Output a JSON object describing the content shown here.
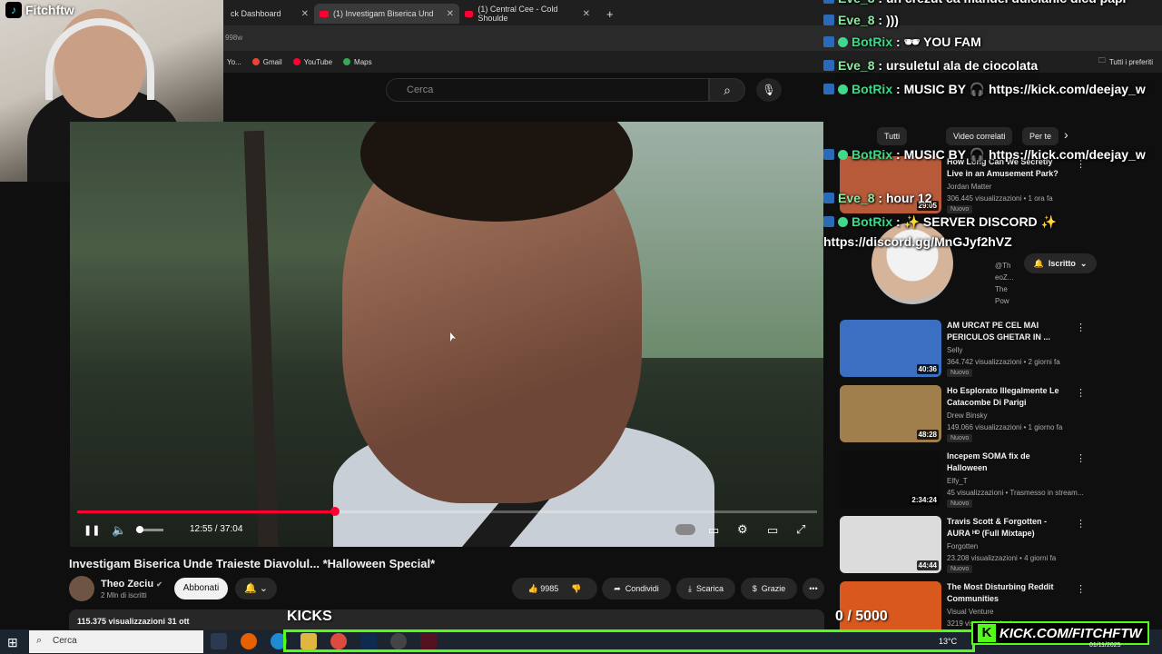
{
  "browser": {
    "tabs": [
      {
        "label": "ck Dashboard"
      },
      {
        "label": "(1) Investigam Biserica Und"
      },
      {
        "label": "(1) Central Cee - Cold Shoulde"
      }
    ],
    "close_glyph": "✕",
    "new_tab_glyph": "+",
    "address_fragment": "998w",
    "bookmarks": [
      {
        "label": "Yo..."
      },
      {
        "label": "Gmail"
      },
      {
        "label": "YouTube"
      },
      {
        "label": "Maps"
      }
    ],
    "all_bookmarks": "Tutti i preferiti"
  },
  "stream": {
    "streamer": "Fitchftw",
    "kicks_label": "KICKS",
    "kicks_count": "0 / 5000",
    "kick_url": "KICK.COM/FITCHFTW",
    "accent": "#53fc18"
  },
  "chat": [
    {
      "user": "Eve_8",
      "sep": " : ",
      "text": "un crezut ca manuel dulcianic dicu papi",
      "type": "eve"
    },
    {
      "user": "Eve_8",
      "sep": " : ",
      "text": ")))",
      "type": "eve"
    },
    {
      "user": "BotRix",
      "sep": " : ",
      "text": "🕶 YOU FAM",
      "type": "bot"
    },
    {
      "user": "Eve_8",
      "sep": " : ",
      "text": "ursuletul ala de ciocolata",
      "type": "eve"
    },
    {
      "user": "BotRix",
      "sep": " : ",
      "text": "MUSIC BY 🎧 https://kick.com/deejay_w",
      "type": "bot"
    },
    {
      "user": "BotRix",
      "sep": " : ",
      "text": "MUSIC BY 🎧 https://kick.com/deejay_w",
      "type": "bot"
    },
    {
      "user": "Eve_8",
      "sep": " : ",
      "text": "hour 12",
      "type": "eve"
    },
    {
      "user": "BotRix",
      "sep": " : ",
      "text": "✨ SERVER DISCORD ✨",
      "type": "bot"
    },
    {
      "user": "",
      "sep": "",
      "text": "https://discord.gg/MnGJyf2hVZ",
      "type": "plain"
    }
  ],
  "youtube": {
    "search_placeholder": "Cerca",
    "search_icon": "search-icon",
    "mic_icon": "mic-icon",
    "player": {
      "time": "12:55 / 37:04",
      "progress": 0.348,
      "pause_glyph": "❚❚",
      "volume_glyph": "🔈",
      "cc_glyph": "▭",
      "settings_glyph": "⚙",
      "theater_glyph": "▭",
      "fullscreen_glyph": "⤢"
    },
    "video_title": "Investigam Biserica Unde Traieste Diavolul... *Halloween Special*",
    "channel": {
      "name": "Theo Zeciu",
      "subs": "2 Mln di iscritti",
      "subscribe": "Abbonati",
      "bell": "🔔 ⌄"
    },
    "actions": {
      "likes": "9985",
      "dislike": "👎",
      "share": "Condividi",
      "download": "Scarica",
      "thanks": "Grazie",
      "more": "•••"
    },
    "views_line": "115.375 visualizzazioni  31 ott",
    "chips": [
      "Tutti",
      "Video correlati",
      "Per te"
    ],
    "chip_next": "›",
    "subscribed_label": "Iscritto",
    "card_text": [
      "@Th",
      "eoZ...",
      "The",
      "Pow"
    ],
    "recs": [
      {
        "title": "How Long Can We Secretly Live in an Amusement Park?",
        "channel": "Jordan Matter",
        "meta": "306.445 visualizzazioni • 1 ora fa",
        "duration": "29:05",
        "badge": "Nuovo",
        "color": "#b65a3a"
      },
      {
        "title": "AM URCAT PE CEL MAI PERICULOS GHETAR IN ...",
        "channel": "Selly",
        "meta": "364.742 visualizzazioni • 2 giorni fa",
        "duration": "40:36",
        "badge": "Nuovo",
        "color": "#3b6fc2"
      },
      {
        "title": "Ho Esplorato Illegalmente Le Catacombe Di Parigi",
        "channel": "Drew Binsky",
        "meta": "149.066 visualizzazioni • 1 giorno fa",
        "duration": "48:28",
        "badge": "Nuovo",
        "color": "#a07f4c"
      },
      {
        "title": "Incepem SOMA fix de Halloween",
        "channel": "Elfy_T",
        "meta": "45 visualizzazioni • Trasmesso in stream...",
        "duration": "2:34:24",
        "badge": "Nuovo",
        "color": "#0d0d0d"
      },
      {
        "title": "Travis Scott & Forgotten - AURA ᴴᴰ (Full Mixtape)",
        "channel": "Forgotten",
        "meta": "23.208 visualizzazioni • 4 giorni fa",
        "duration": "44:44",
        "badge": "Nuovo",
        "color": "#dcdcdc"
      },
      {
        "title": "The Most Disturbing Reddit Communities",
        "channel": "Visual Venture",
        "meta": "3219 visualizzazioni",
        "duration": "",
        "badge": "",
        "color": "#d9581e"
      }
    ]
  },
  "taskbar": {
    "search": "Cerca",
    "weather": "13°C",
    "date": "01/11/2025"
  }
}
